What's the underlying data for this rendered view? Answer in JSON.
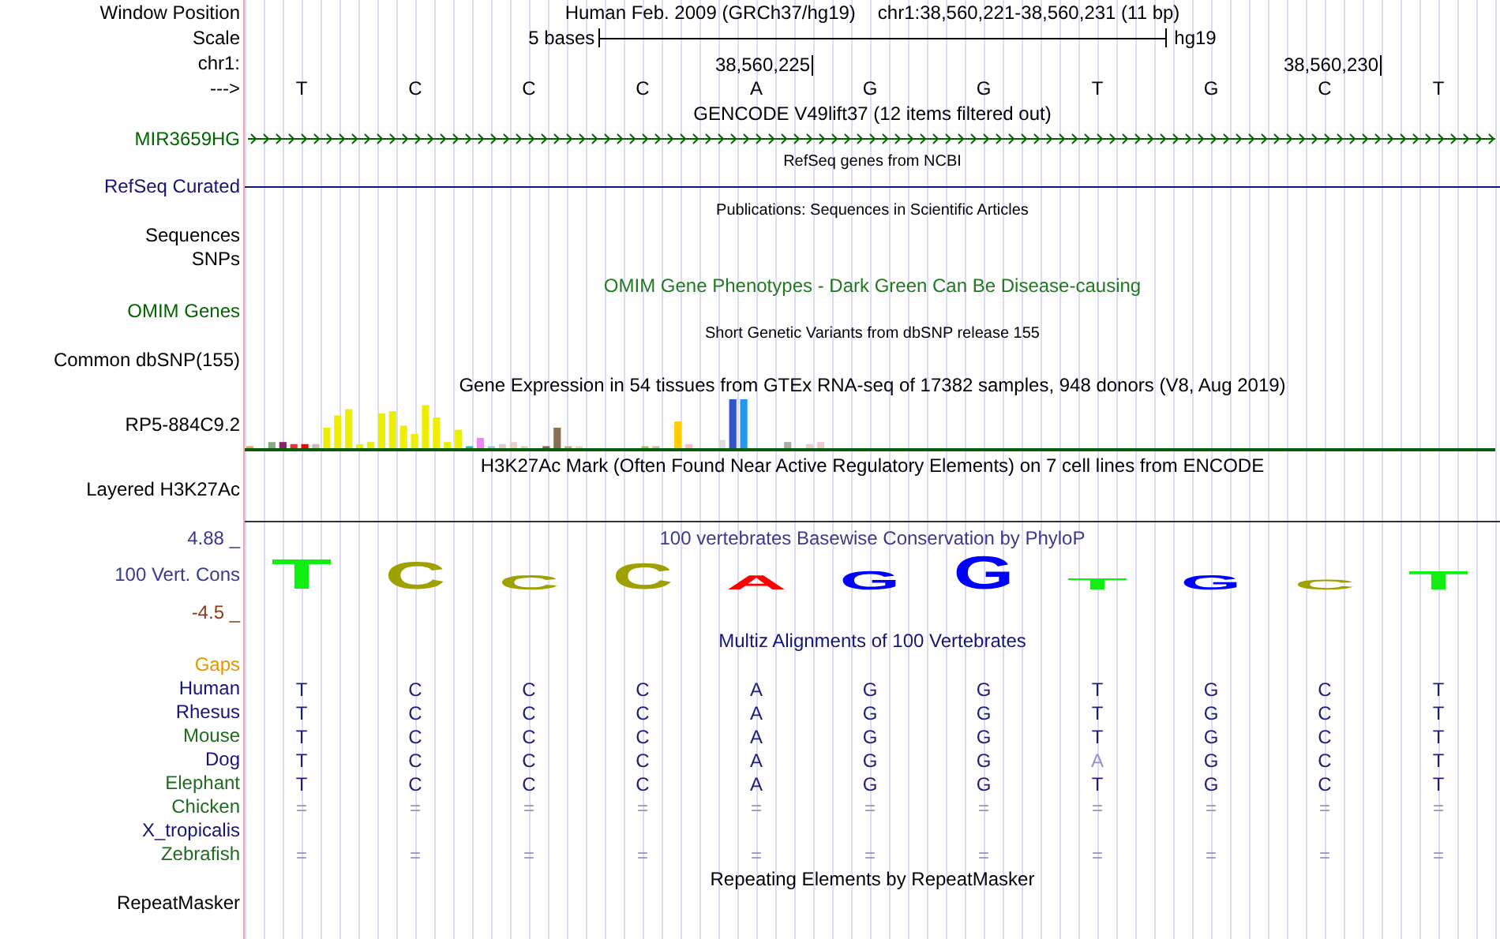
{
  "position": {
    "label": "Window Position",
    "assembly": "Human Feb. 2009 (GRCh37/hg19)",
    "range": "chr1:38,560,221-38,560,231 (11 bp)"
  },
  "scale": {
    "label": "Scale",
    "span": "5 bases",
    "db": "hg19"
  },
  "coordinates": {
    "label": "chr1:",
    "ticks": [
      "38,560,225",
      "38,560,230"
    ]
  },
  "sequence": {
    "label": "--->",
    "bases": [
      "T",
      "C",
      "C",
      "C",
      "A",
      "G",
      "G",
      "T",
      "G",
      "C",
      "T"
    ]
  },
  "tracks": [
    {
      "kind": "gene",
      "title": "GENCODE V49lift37 (12 items filtered out)",
      "labels": [
        "MIR3659HG"
      ],
      "color": "#006400"
    },
    {
      "kind": "refseq",
      "title": "RefSeq genes from NCBI",
      "labels": [
        "RefSeq Curated"
      ],
      "color": "#14147a"
    },
    {
      "kind": "publications",
      "title": "Publications: Sequences in Scientific Articles",
      "labels": [
        "Sequences",
        "SNPs"
      ],
      "color": "#000000"
    },
    {
      "kind": "omim",
      "title": "OMIM Gene Phenotypes - Dark Green Can Be Disease-causing",
      "labels": [
        "OMIM Genes"
      ],
      "color": "#006400"
    },
    {
      "kind": "snp",
      "title": "Short Genetic Variants from dbSNP release 155",
      "labels": [
        "Common dbSNP(155)"
      ],
      "color": "#000000"
    },
    {
      "kind": "expression",
      "title": "Gene Expression in 54 tissues from GTEx RNA-seq of 17382 samples, 948 donors (V8, Aug 2019)",
      "labels": [
        "RP5-884C9.2"
      ],
      "color": "#000000"
    },
    {
      "kind": "signal",
      "title": "H3K27Ac Mark (Often Found Near Active Regulatory Elements) on 7 cell lines from ENCODE",
      "labels": [
        "Layered H3K27Ac"
      ],
      "color": "#000000"
    },
    {
      "kind": "conservation",
      "title": "100 vertebrates Basewise Conservation by PhyloP",
      "labels": [
        "100 Vert. Cons"
      ],
      "color": "#3a3a8c",
      "max": "4.88 _",
      "min": "-4.5 _",
      "logo": [
        {
          "base": "T",
          "color": "#11ee11"
        },
        {
          "base": "C",
          "color": "#a0a000"
        },
        {
          "base": "C",
          "color": "#a0a000"
        },
        {
          "base": "C",
          "color": "#a0a000"
        },
        {
          "base": "A",
          "color": "#ff0000"
        },
        {
          "base": "G",
          "color": "#0000ff"
        },
        {
          "base": "G",
          "color": "#0000ff"
        },
        {
          "base": "T",
          "color": "#11ee11"
        },
        {
          "base": "G",
          "color": "#0000ff"
        },
        {
          "base": "C",
          "color": "#a0a000"
        },
        {
          "base": "T",
          "color": "#11ee11"
        }
      ]
    },
    {
      "kind": "multiz",
      "title": "Multiz Alignments of 100 Vertebrates",
      "labels": [
        "Gaps"
      ],
      "color": "#e69500",
      "species": [
        {
          "name": "Human",
          "color": "#14147a",
          "bases": [
            {
              "base": "T",
              "match": true
            },
            {
              "base": "C",
              "match": true
            },
            {
              "base": "C",
              "match": true
            },
            {
              "base": "C",
              "match": true
            },
            {
              "base": "A",
              "match": true
            },
            {
              "base": "G",
              "match": true
            },
            {
              "base": "G",
              "match": true
            },
            {
              "base": "T",
              "match": true
            },
            {
              "base": "G",
              "match": true
            },
            {
              "base": "C",
              "match": true
            },
            {
              "base": "T",
              "match": true
            }
          ]
        },
        {
          "name": "Rhesus",
          "color": "#14147a",
          "bases": [
            {
              "base": "T",
              "match": true
            },
            {
              "base": "C",
              "match": true
            },
            {
              "base": "C",
              "match": true
            },
            {
              "base": "C",
              "match": true
            },
            {
              "base": "A",
              "match": true
            },
            {
              "base": "G",
              "match": true
            },
            {
              "base": "G",
              "match": true
            },
            {
              "base": "T",
              "match": true
            },
            {
              "base": "G",
              "match": true
            },
            {
              "base": "C",
              "match": true
            },
            {
              "base": "T",
              "match": true
            }
          ]
        },
        {
          "name": "Mouse",
          "color": "#1f6b1f",
          "bases": [
            {
              "base": "T",
              "match": true
            },
            {
              "base": "C",
              "match": true
            },
            {
              "base": "C",
              "match": true
            },
            {
              "base": "C",
              "match": true
            },
            {
              "base": "A",
              "match": true
            },
            {
              "base": "G",
              "match": true
            },
            {
              "base": "G",
              "match": true
            },
            {
              "base": "T",
              "match": true
            },
            {
              "base": "G",
              "match": true
            },
            {
              "base": "C",
              "match": true
            },
            {
              "base": "T",
              "match": true
            }
          ]
        },
        {
          "name": "Dog",
          "color": "#14147a",
          "bases": [
            {
              "base": "T",
              "match": true
            },
            {
              "base": "C",
              "match": true
            },
            {
              "base": "C",
              "match": true
            },
            {
              "base": "C",
              "match": true
            },
            {
              "base": "A",
              "match": true
            },
            {
              "base": "G",
              "match": true
            },
            {
              "base": "G",
              "match": true
            },
            {
              "base": "A",
              "match": false
            },
            {
              "base": "G",
              "match": true
            },
            {
              "base": "C",
              "match": true
            },
            {
              "base": "T",
              "match": true
            }
          ]
        },
        {
          "name": "Elephant",
          "color": "#1f6b1f",
          "bases": [
            {
              "base": "T",
              "match": true
            },
            {
              "base": "C",
              "match": true
            },
            {
              "base": "C",
              "match": true
            },
            {
              "base": "C",
              "match": true
            },
            {
              "base": "A",
              "match": true
            },
            {
              "base": "G",
              "match": true
            },
            {
              "base": "G",
              "match": true
            },
            {
              "base": "T",
              "match": true
            },
            {
              "base": "G",
              "match": true
            },
            {
              "base": "C",
              "match": true
            },
            {
              "base": "T",
              "match": true
            }
          ]
        },
        {
          "name": "Chicken",
          "color": "#1f6b1f",
          "bases": [
            {
              "base": "=",
              "match": false
            },
            {
              "base": "=",
              "match": false
            },
            {
              "base": "=",
              "match": false
            },
            {
              "base": "=",
              "match": false
            },
            {
              "base": "=",
              "match": false
            },
            {
              "base": "=",
              "match": false
            },
            {
              "base": "=",
              "match": false
            },
            {
              "base": "=",
              "match": false
            },
            {
              "base": "=",
              "match": false
            },
            {
              "base": "=",
              "match": false
            },
            {
              "base": "=",
              "match": false
            }
          ]
        },
        {
          "name": "X_tropicalis",
          "color": "#14147a"
        },
        {
          "name": "Zebrafish",
          "color": "#1f6b1f",
          "bases": [
            {
              "base": "=",
              "match": false
            },
            {
              "base": "=",
              "match": false
            },
            {
              "base": "=",
              "match": false
            },
            {
              "base": "=",
              "match": false
            },
            {
              "base": "=",
              "match": false
            },
            {
              "base": "=",
              "match": false
            },
            {
              "base": "=",
              "match": false
            },
            {
              "base": "=",
              "match": false
            },
            {
              "base": "=",
              "match": false
            },
            {
              "base": "=",
              "match": false
            },
            {
              "base": "=",
              "match": false
            }
          ]
        }
      ]
    },
    {
      "kind": "repeat",
      "title": "Repeating Elements by RepeatMasker",
      "labels": [
        "RepeatMasker"
      ],
      "color": "#000000"
    }
  ]
}
